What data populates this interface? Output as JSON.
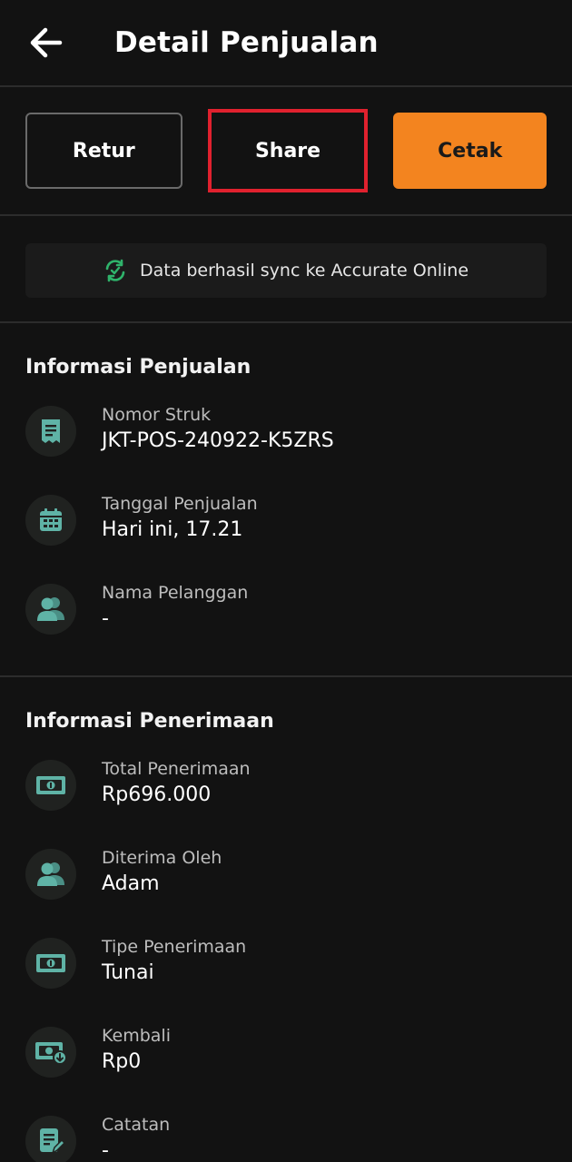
{
  "header": {
    "title": "Detail Penjualan"
  },
  "actions": {
    "retur": "Retur",
    "share": "Share",
    "cetak": "Cetak"
  },
  "sync": {
    "message": "Data berhasil sync ke Accurate Online"
  },
  "sales_info": {
    "title": "Informasi Penjualan",
    "items": [
      {
        "label": "Nomor Struk",
        "value": "JKT-POS-240922-K5ZRS",
        "icon": "receipt-icon"
      },
      {
        "label": "Tanggal Penjualan",
        "value": "Hari ini, 17.21",
        "icon": "calendar-icon"
      },
      {
        "label": "Nama Pelanggan",
        "value": "-",
        "icon": "users-icon"
      }
    ]
  },
  "payment_info": {
    "title": "Informasi Penerimaan",
    "items": [
      {
        "label": "Total Penerimaan",
        "value": "Rp696.000",
        "icon": "cash-icon"
      },
      {
        "label": "Diterima Oleh",
        "value": "Adam",
        "icon": "users-icon"
      },
      {
        "label": "Tipe Penerimaan",
        "value": "Tunai",
        "icon": "cash-icon"
      },
      {
        "label": "Kembali",
        "value": "Rp0",
        "icon": "cash-return-icon"
      },
      {
        "label": "Catatan",
        "value": "-",
        "icon": "note-icon"
      }
    ]
  },
  "colors": {
    "accent": "#f3841f",
    "icon": "#5fb3a6",
    "sync": "#2fb36b",
    "highlight": "#e0212e"
  }
}
